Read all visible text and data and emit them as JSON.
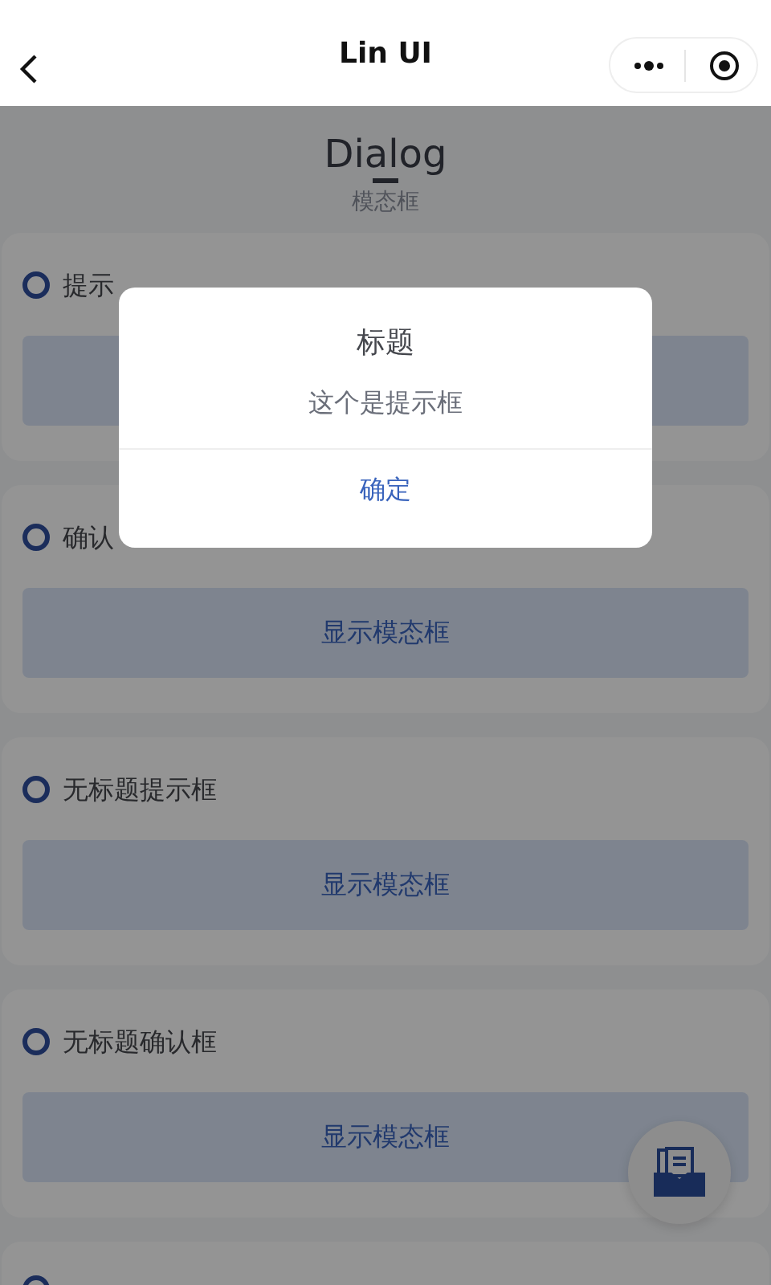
{
  "nav": {
    "title": "Lin UI"
  },
  "header": {
    "title": "Dialog",
    "subtitle": "模态框"
  },
  "sections": [
    {
      "title": "提示"
    },
    {
      "title": "确认",
      "button": "显示模态框"
    },
    {
      "title": "无标题提示框",
      "button": "显示模态框"
    },
    {
      "title": "无标题确认框",
      "button": "显示模态框"
    }
  ],
  "dialog": {
    "title": "标题",
    "content": "这个是提示框",
    "confirm": "确定"
  }
}
